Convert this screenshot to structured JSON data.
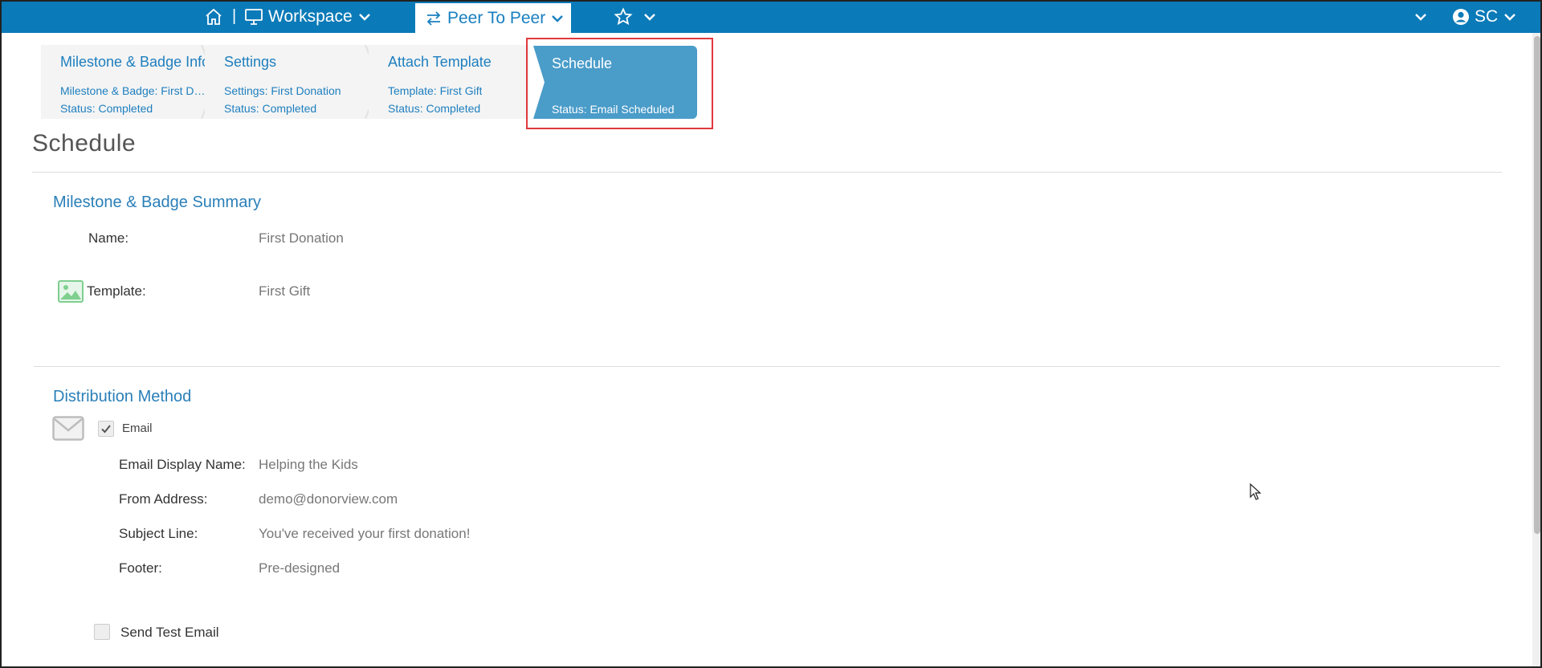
{
  "nav": {
    "separator": "|",
    "workspace_label": "Workspace",
    "module_label": "Peer To Peer",
    "user_initials": "SC"
  },
  "steps": [
    {
      "title": "Milestone & Badge Info",
      "line1": "Milestone & Badge: First Donation",
      "line2": "Status: Completed"
    },
    {
      "title": "Settings",
      "line1": "Settings: First Donation",
      "line2": "Status: Completed"
    },
    {
      "title": "Attach Template",
      "line1": "Template: First Gift",
      "line2": "Status: Completed"
    },
    {
      "title": "Schedule",
      "line2": "Status: Email Scheduled"
    }
  ],
  "page": {
    "title": "Schedule"
  },
  "summary": {
    "title": "Milestone & Badge Summary",
    "name_label": "Name:",
    "name_value": "First Donation",
    "template_label": "Template:",
    "template_value": "First Gift"
  },
  "distribution": {
    "title": "Distribution Method",
    "email_label": "Email",
    "display_name_label": "Email Display Name:",
    "display_name_value": "Helping the Kids",
    "from_label": "From Address:",
    "from_value": "demo@donorview.com",
    "subject_label": "Subject Line:",
    "subject_value": "You've received your first donation!",
    "footer_label": "Footer:",
    "footer_value": "Pre-designed",
    "test_email_label": "Send Test Email"
  },
  "colors": {
    "nav_bg": "#0b7ab8",
    "active_step": "#4a9cc9",
    "accent": "#2a7fb8",
    "highlight": "#e0393e"
  }
}
